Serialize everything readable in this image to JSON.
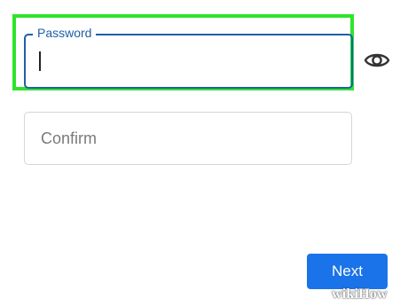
{
  "password": {
    "label": "Password",
    "value": ""
  },
  "confirm": {
    "placeholder": "Confirm"
  },
  "actions": {
    "next_label": "Next"
  },
  "icons": {
    "visibility": "eye-icon"
  },
  "watermark": {
    "text": "wikiHow"
  },
  "colors": {
    "highlight": "#2ee42b",
    "field_focus": "#1e5fa8",
    "button": "#1a73e8"
  }
}
